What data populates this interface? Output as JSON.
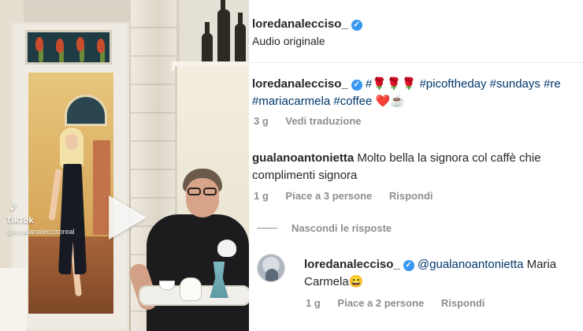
{
  "video": {
    "tiktok_brand": "TikTok",
    "tiktok_handle": "@loredanaleccisoreal",
    "icons": {
      "play": "play-icon",
      "tiktok": "tiktok-icon"
    }
  },
  "header": {
    "username": "loredanalecciso_",
    "subtitle": "Audio originale"
  },
  "caption": {
    "username": "loredanalecciso_",
    "line1_rest": "#🌹🌹🌹 #picoftheday #sundays #re",
    "line2_tags": "#mariacarmela #coffee",
    "line2_emoji": "❤️☕",
    "time": "3 g",
    "translate": "Vedi traduzione"
  },
  "comment": {
    "username": "gualanoantonietta",
    "text": "Molto bella la signora col caffè chie complimenti signora",
    "time": "1 g",
    "likes": "Piace a 3 persone",
    "reply": "Rispondi"
  },
  "replies_toggle": {
    "label": "Nascondi le risposte"
  },
  "reply": {
    "username": "loredanalecciso_",
    "mention": "@gualanoantonietta",
    "text": "Maria Carmela😄",
    "time": "1 g",
    "likes": "Piace a 2 persone",
    "reply": "Rispondi"
  },
  "colors": {
    "verified": "#3897f0",
    "hashtag": "#00376b",
    "meta": "#8e8e8e",
    "heart": "#ed4956"
  }
}
